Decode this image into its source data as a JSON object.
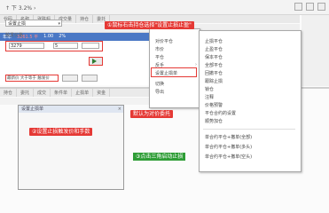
{
  "window": {
    "title": "↑ 下 3.2% ›"
  },
  "top_tabs": [
    "代码",
    "名称",
    "涨跌幅",
    "成交量",
    "持仓",
    "委托"
  ],
  "top_row": {
    "name": "年年",
    "price": "3261.5 平",
    "change": "1.00",
    "pct": "2%"
  },
  "bottom_tabs": [
    "持仓",
    "委托",
    "成交",
    "条件单",
    "止损单",
    "资金"
  ],
  "dialog": {
    "title": "设置止损单",
    "type_select": "设置止损",
    "price_label": "触发价格",
    "price_value": "3279",
    "qty_value": "5",
    "condition_text": "最新价 大于等于 触发价"
  },
  "callouts": {
    "step1": "①鼠标右击持仓选择\"设置止损止盈\"",
    "step2": "②设置止损触发价和手数",
    "step3": "默认为对价委托",
    "step4": "③点击三角启动止损"
  },
  "context_menu": {
    "items": [
      "对价平仓",
      "市价",
      "平仓",
      "反手",
      "止损止盈",
      "设置止损单",
      "切换",
      "导出"
    ],
    "selected": "设置止损单"
  },
  "submenu": {
    "items": [
      "止损平仓",
      "止盈平仓",
      "保本平仓",
      "全部平仓",
      "回撤平仓",
      "跟踪止损",
      "锁仓",
      "注释",
      "价格预警",
      "平仓合约的设置",
      "顺势加仓",
      "单合约平仓+撤单(全部)",
      "单合约平仓+撤单(多头)",
      "单合约平仓+撤单(空头)"
    ]
  }
}
